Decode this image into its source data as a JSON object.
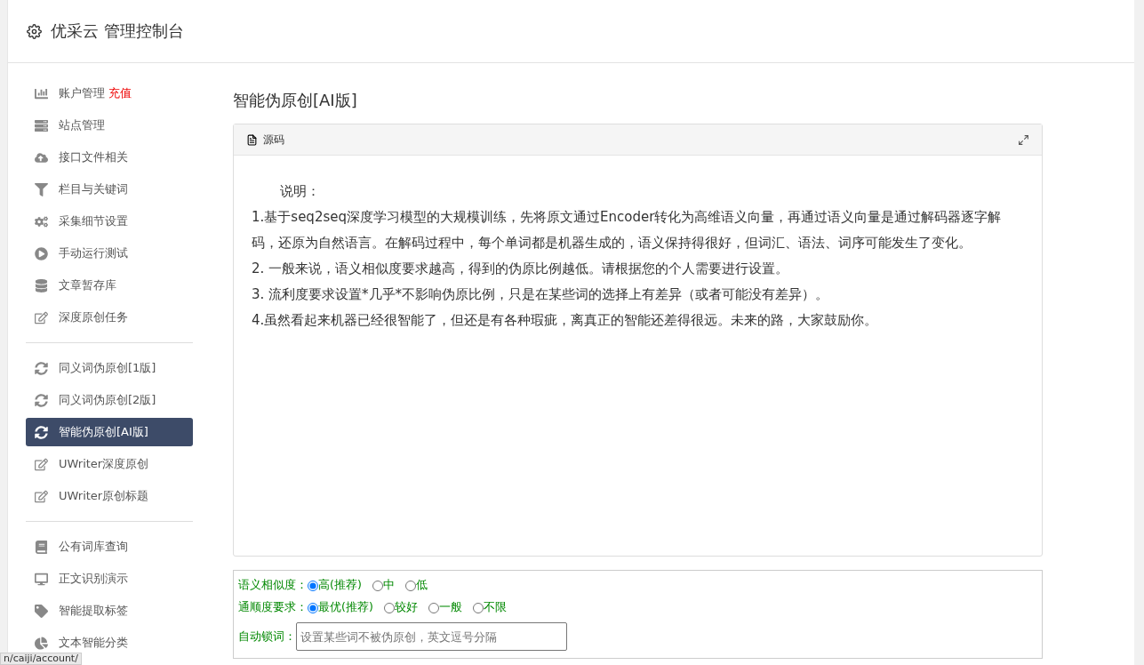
{
  "header": {
    "title": "优采云 管理控制台"
  },
  "sidebar": {
    "groups": [
      {
        "items": [
          {
            "label": "账户管理",
            "badge": "充值",
            "selected": false
          },
          {
            "label": "站点管理",
            "selected": false
          },
          {
            "label": "接口文件相关",
            "selected": false
          },
          {
            "label": "栏目与关键词",
            "selected": false
          },
          {
            "label": "采集细节设置",
            "selected": false
          },
          {
            "label": "手动运行测试",
            "selected": false
          },
          {
            "label": "文章暂存库",
            "selected": false
          },
          {
            "label": "深度原创任务",
            "selected": false
          }
        ]
      },
      {
        "items": [
          {
            "label": "同义词伪原创[1版]",
            "selected": false
          },
          {
            "label": "同义词伪原创[2版]",
            "selected": false
          },
          {
            "label": "智能伪原创[AI版]",
            "selected": true
          },
          {
            "label": "UWriter深度原创",
            "selected": false
          },
          {
            "label": "UWriter原创标题",
            "selected": false
          }
        ]
      },
      {
        "items": [
          {
            "label": "公有词库查询",
            "selected": false
          },
          {
            "label": "正文识别演示",
            "selected": false
          },
          {
            "label": "智能提取标签",
            "selected": false
          },
          {
            "label": "文本智能分类",
            "selected": false
          }
        ]
      }
    ]
  },
  "page_title": "智能伪原创[AI版]",
  "editor": {
    "toolbar_label": "源码",
    "lines": [
      "说明：",
      "1.基于seq2seq深度学习模型的大规模训练，先将原文通过Encoder转化为高维语义向量，再通过语义向量是通过解码器逐字解码，还原为自然语言。在解码过程中，每个单词都是机器生成的，语义保持得很好，但词汇、语法、词序可能发生了变化。",
      "2. 一般来说，语义相似度要求越高，得到的伪原比例越低。请根据您的个人需要进行设置。",
      "3. 流利度要求设置*几乎*不影响伪原比例，只是在某些词的选择上有差异（或者可能没有差异）。",
      "4.虽然看起来机器已经很智能了，但还是有各种瑕疵，离真正的智能还差得很远。未来的路，大家鼓励你。"
    ]
  },
  "form": {
    "similarity": {
      "label": "语义相似度：",
      "options": [
        {
          "label": "高(推荐)",
          "selected": true
        },
        {
          "label": "中",
          "selected": false
        },
        {
          "label": "低",
          "selected": false
        }
      ]
    },
    "fluency": {
      "label": "通顺度要求：",
      "options": [
        {
          "label": "最优(推荐)",
          "selected": true
        },
        {
          "label": "较好",
          "selected": false
        },
        {
          "label": "一般",
          "selected": false
        },
        {
          "label": "不限",
          "selected": false
        }
      ]
    },
    "lock_words": {
      "label": "自动锁词：",
      "placeholder": "设置某些词不被伪原创，英文逗号分隔"
    }
  },
  "status_url": "n/caiji/account/"
}
